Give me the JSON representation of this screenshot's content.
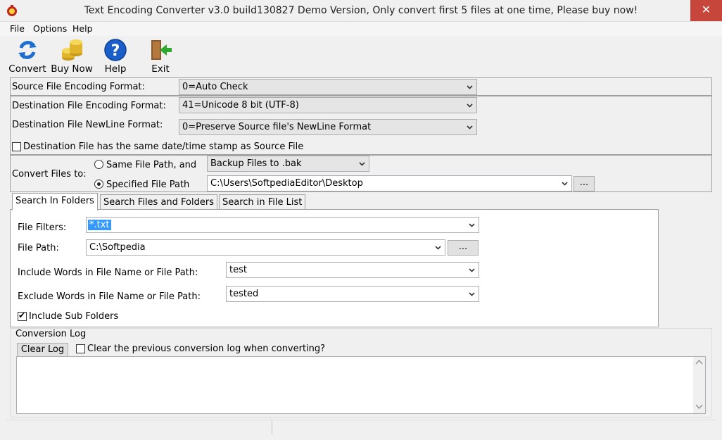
{
  "window": {
    "title": "Text Encoding Converter v3.0 build130827 Demo Version, Only convert first 5 files at one time, Please buy now!",
    "close_glyph": "✕"
  },
  "menu": [
    "File",
    "Options",
    "Help"
  ],
  "toolbar": {
    "convert": "Convert",
    "buy_now": "Buy Now",
    "help": "Help",
    "exit": "Exit"
  },
  "source": {
    "label": "Source File Encoding Format:",
    "value": "0=Auto Check"
  },
  "destination": {
    "encoding_label": "Destination File Encoding Format:",
    "encoding_value": "41=Unicode 8 bit (UTF-8)",
    "newline_label": "Destination File NewLine Format:",
    "newline_value": "0=Preserve Source file's NewLine Format",
    "timestamp_label": "Destination File has the same date/time stamp as Source File",
    "timestamp_checked": false
  },
  "convert_to": {
    "label": "Convert Files to:",
    "same_path_label": "Same File Path, and",
    "same_path_selected": false,
    "backup_value": "Backup Files to .bak",
    "specified_path_label": "Specified File Path",
    "specified_path_selected": true,
    "path_value": "C:\\Users\\SoftpediaEditor\\Desktop",
    "browse_label": "..."
  },
  "tabs": [
    "Search In Folders",
    "Search Files and Folders",
    "Search in File List"
  ],
  "search": {
    "filters_label": "File Filters:",
    "filters_value": "*.txt",
    "path_label": "File Path:",
    "path_value": "C:\\Softpedia",
    "browse_label": "...",
    "include_label": "Include Words in File Name or File Path:",
    "include_value": "test",
    "exclude_label": "Exclude Words in File Name or File Path:",
    "exclude_value": "tested",
    "subfolders_label": "Include Sub Folders",
    "subfolders_checked": true
  },
  "log": {
    "group_label": "Conversion Log",
    "clear_button": "Clear Log",
    "clear_previous_label": "Clear the previous conversion log when converting?",
    "clear_previous_checked": false
  },
  "colors": {
    "titlebar_close": "#c7463b",
    "selection": "#3399ff"
  }
}
